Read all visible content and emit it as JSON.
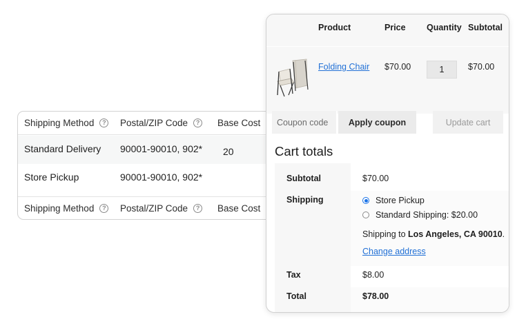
{
  "rules_table": {
    "headers": {
      "shipping_method": "Shipping Method",
      "postal_zip": "Postal/ZIP Code",
      "base_cost": "Base Cost"
    },
    "rows": [
      {
        "method": "Standard Delivery",
        "postal": "90001-90010, 902*",
        "base_cost": "20"
      },
      {
        "method": "Store Pickup",
        "postal": "90001-90010, 902*",
        "base_cost": ""
      }
    ],
    "help_icon": "question-circle-icon"
  },
  "cart": {
    "headers": {
      "product": "Product",
      "price": "Price",
      "quantity": "Quantity",
      "subtotal": "Subtotal"
    },
    "item": {
      "name": "Folding Chair",
      "price": "$70.00",
      "quantity": "1",
      "subtotal": "$70.00"
    },
    "coupon_placeholder": "Coupon code",
    "apply_coupon": "Apply coupon",
    "update_cart": "Update cart"
  },
  "totals": {
    "title": "Cart totals",
    "subtotal_label": "Subtotal",
    "subtotal_value": "$70.00",
    "shipping_label": "Shipping",
    "shipping_options": [
      {
        "label": "Store Pickup",
        "selected": true
      },
      {
        "label": "Standard Shipping: $20.00",
        "selected": false
      }
    ],
    "shipping_to_prefix": "Shipping to",
    "shipping_to_location": "Los Angeles, CA 90010",
    "shipping_to_suffix": ".",
    "change_address": "Change address",
    "tax_label": "Tax",
    "tax_value": "$8.00",
    "total_label": "Total",
    "total_value": "$78.00"
  },
  "colors": {
    "link": "#2170d6",
    "radio_selected": "#1a73e8"
  }
}
